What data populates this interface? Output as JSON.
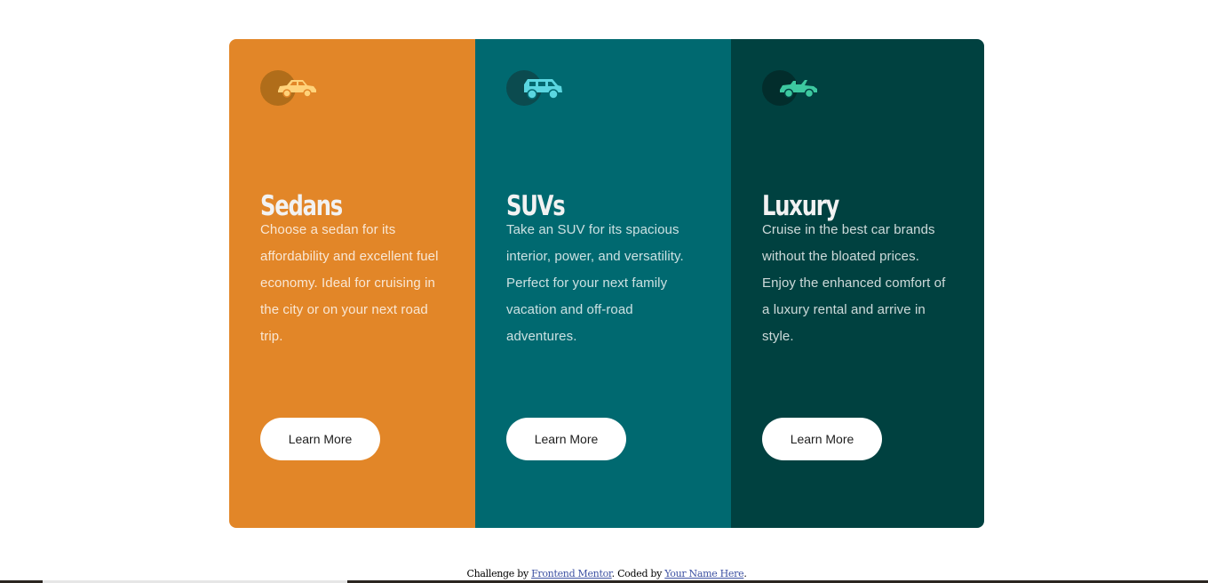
{
  "colors": {
    "sedans": "#e28628",
    "suvs": "#006970",
    "luxury": "#004140",
    "button_bg": "#ffffff"
  },
  "cards": [
    {
      "icon": "sedan-car-icon",
      "title": "Sedans",
      "text": "Choose a sedan for its affordability and excellent fuel economy. Ideal for cruising in the city or on your next road trip.",
      "button": "Learn More"
    },
    {
      "icon": "suv-car-icon",
      "title": "SUVs",
      "text": "Take an SUV for its spacious interior, power, and versatility. Perfect for your next family vacation and off-road adventures.",
      "button": "Learn More"
    },
    {
      "icon": "luxury-car-icon",
      "title": "Luxury",
      "text": "Cruise in the best car brands without the bloated prices. Enjoy the enhanced comfort of a luxury rental and arrive in style.",
      "button": "Learn More"
    }
  ],
  "attribution": {
    "prefix": "Challenge by ",
    "challenge_link": "Frontend Mentor",
    "middle": ". Coded by ",
    "author_link": "Your Name Here",
    "suffix": "."
  }
}
